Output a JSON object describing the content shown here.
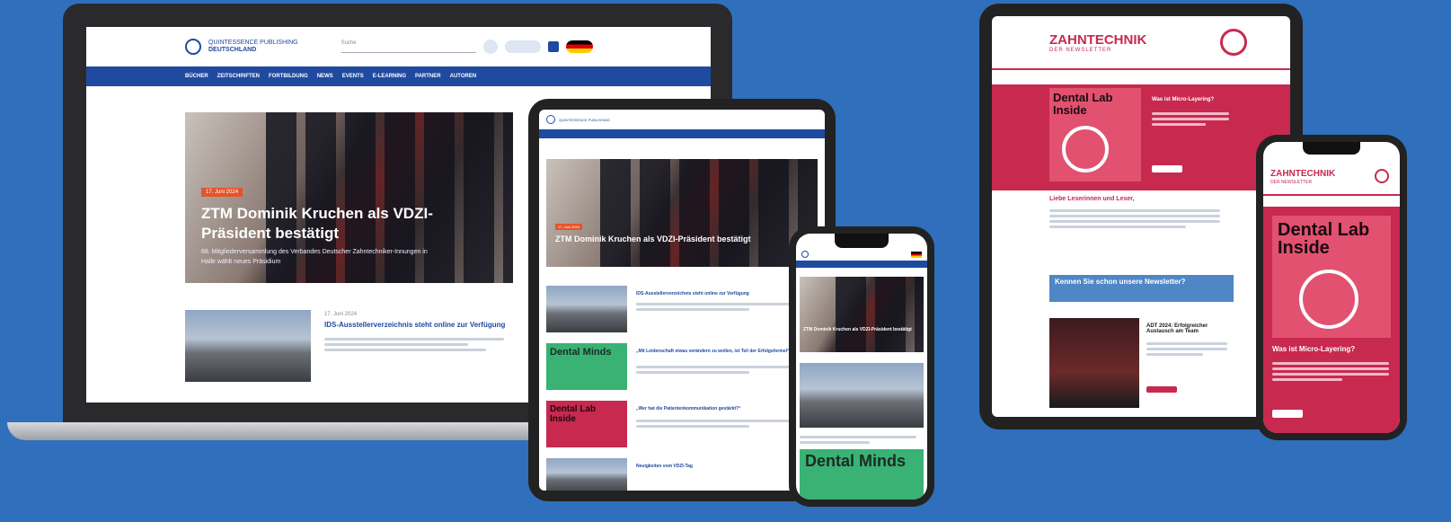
{
  "brand": {
    "line1": "QUINTESSENCE PUBLISHING",
    "line2": "DEUTSCHLAND"
  },
  "laptop": {
    "search_placeholder": "Suche",
    "nav": [
      "BÜCHER",
      "ZEITSCHRIFTEN",
      "FORTBILDUNG",
      "NEWS",
      "EVENTS",
      "E-LEARNING",
      "PARTNER",
      "AUTOREN"
    ],
    "hero_badge": "17. Juni 2024",
    "hero_title": "ZTM Dominik Kruchen als VDZI-Präsident bestätigt",
    "hero_sub": "68. Mitgliederversammlung des Verbandes Deutscher Zahntechniker-Innungen in Halle wählt neues Präsidium",
    "article_date": "17. Juni 2024",
    "article_title": "IDS-Ausstellerverzeichnis steht online zur Verfügung"
  },
  "tablet": {
    "hero_badge": "17. Juni 2024",
    "hero_title": "ZTM Dominik Kruchen als VDZI-Präsident bestätigt",
    "items": [
      {
        "title": "IDS-Ausstellerverzeichnis steht online zur Verfügung"
      },
      {
        "thumb": "Dental Minds",
        "title": "„Mit Leidenschaft etwas verändern zu wollen, ist Teil der Erfolgsformel“"
      },
      {
        "thumb": "Dental Lab Inside",
        "title": "„Wer hat die Patientenkommunikation gestärkt?“"
      },
      {
        "title": "Neuigkeiten vom VDZI-Tag"
      }
    ]
  },
  "phone_left": {
    "hero_title": "ZTM Dominik Kruchen als VDZI-Präsident bestätigt",
    "thumb": "Dental Minds"
  },
  "newsletter": {
    "title": "ZAHNTECHNIK",
    "subtitle": "DER NEWSLETTER",
    "cover": "Dental Lab Inside",
    "section_title": "Liebe Leserinnen und Leser,",
    "banner": "Kennen Sie schon unsere Newsletter?",
    "article_title": "ADT 2024: Erfolgreicher Austausch am Team",
    "cover_question": "Was ist Micro-Layering?"
  },
  "phone_right": {
    "title": "ZAHNTECHNIK",
    "subtitle": "DER NEWSLETTER",
    "cover": "Dental Lab Inside",
    "question": "Was ist Micro-Layering?"
  },
  "colors": {
    "background": "#2f6fbb",
    "brand_blue": "#1f4aa0",
    "newsletter_red": "#c8294f",
    "dental_minds_green": "#39b274"
  }
}
